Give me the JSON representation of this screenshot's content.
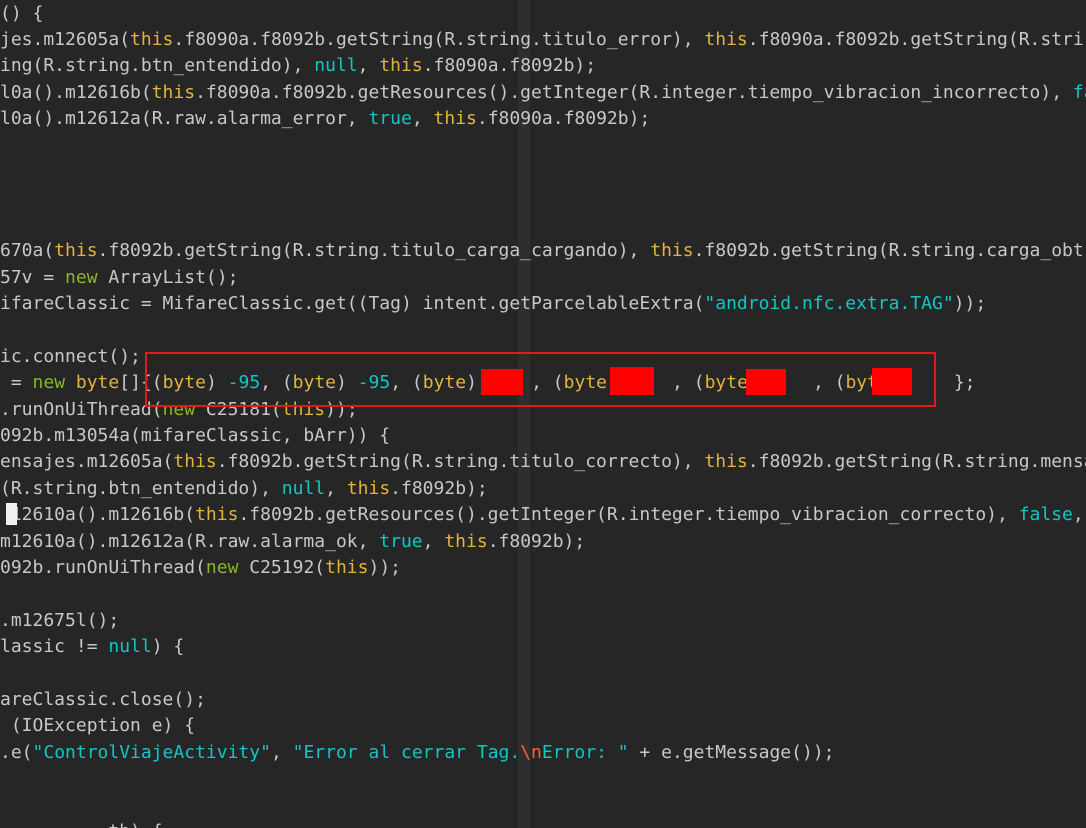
{
  "editor": {
    "lines": [
      {
        "parts": [
          {
            "t": "() {",
            "c": "plain"
          }
        ]
      },
      {
        "parts": [
          {
            "t": "jes.m12605a(",
            "c": "plain"
          },
          {
            "t": "this",
            "c": "this"
          },
          {
            "t": ".f8090a.f8092b.getString(R.string.titulo_error), ",
            "c": "plain"
          },
          {
            "t": "this",
            "c": "this"
          },
          {
            "t": ".f8090a.f8092b.getString(R.stri",
            "c": "plain"
          }
        ]
      },
      {
        "parts": [
          {
            "t": "ing(R.string.btn_entendido), ",
            "c": "plain"
          },
          {
            "t": "null",
            "c": "const"
          },
          {
            "t": ", ",
            "c": "plain"
          },
          {
            "t": "this",
            "c": "this"
          },
          {
            "t": ".f8090a.f8092b);",
            "c": "plain"
          }
        ]
      },
      {
        "parts": [
          {
            "t": "l0a().m12616b(",
            "c": "plain"
          },
          {
            "t": "this",
            "c": "this"
          },
          {
            "t": ".f8090a.f8092b.getResources().getInteger(R.integer.tiempo_vibracion_incorrecto), ",
            "c": "plain"
          },
          {
            "t": "fa",
            "c": "const"
          }
        ]
      },
      {
        "parts": [
          {
            "t": "l0a().m12612a(R.raw.alarma_error, ",
            "c": "plain"
          },
          {
            "t": "true",
            "c": "const"
          },
          {
            "t": ", ",
            "c": "plain"
          },
          {
            "t": "this",
            "c": "this"
          },
          {
            "t": ".f8090a.f8092b);",
            "c": "plain"
          }
        ]
      },
      {
        "parts": []
      },
      {
        "parts": []
      },
      {
        "parts": []
      },
      {
        "parts": []
      },
      {
        "parts": [
          {
            "t": "670a(",
            "c": "plain"
          },
          {
            "t": "this",
            "c": "this"
          },
          {
            "t": ".f8092b.getString(R.string.titulo_carga_cargando), ",
            "c": "plain"
          },
          {
            "t": "this",
            "c": "this"
          },
          {
            "t": ".f8092b.getString(R.string.carga_obt",
            "c": "plain"
          }
        ]
      },
      {
        "parts": [
          {
            "t": "57v = ",
            "c": "plain"
          },
          {
            "t": "new",
            "c": "new"
          },
          {
            "t": " ArrayList();",
            "c": "plain"
          }
        ]
      },
      {
        "parts": [
          {
            "t": "ifareClassic = MifareClassic.get((Tag) intent.getParcelableExtra(",
            "c": "plain"
          },
          {
            "t": "\"android.nfc.extra.TAG\"",
            "c": "str"
          },
          {
            "t": "));",
            "c": "plain"
          }
        ]
      },
      {
        "parts": []
      },
      {
        "parts": [
          {
            "t": "ic.connect();",
            "c": "plain"
          }
        ]
      },
      {
        "parts": [
          {
            "t": " = ",
            "c": "plain"
          },
          {
            "t": "new",
            "c": "new"
          },
          {
            "t": " ",
            "c": "plain"
          },
          {
            "t": "byte",
            "c": "kw"
          },
          {
            "t": "[]{(",
            "c": "plain"
          },
          {
            "t": "byte",
            "c": "kw"
          },
          {
            "t": ") ",
            "c": "plain"
          },
          {
            "t": "-95",
            "c": "num"
          },
          {
            "t": ", (",
            "c": "plain"
          },
          {
            "t": "byte",
            "c": "kw"
          },
          {
            "t": ") ",
            "c": "plain"
          },
          {
            "t": "-95",
            "c": "num"
          },
          {
            "t": ", (",
            "c": "plain"
          },
          {
            "t": "byte",
            "c": "kw"
          },
          {
            "t": ")     , (",
            "c": "plain"
          },
          {
            "t": "byte",
            "c": "kw"
          },
          {
            "t": ")     , (",
            "c": "plain"
          },
          {
            "t": "byte",
            "c": "kw"
          },
          {
            "t": ")     , (",
            "c": "plain"
          },
          {
            "t": "byte",
            "c": "kw"
          },
          {
            "t": ")     };",
            "c": "plain"
          }
        ]
      },
      {
        "parts": [
          {
            "t": ".runOnUiThread(",
            "c": "plain"
          },
          {
            "t": "new",
            "c": "new"
          },
          {
            "t": " C25181(",
            "c": "plain"
          },
          {
            "t": "this",
            "c": "this"
          },
          {
            "t": "));",
            "c": "plain"
          }
        ]
      },
      {
        "parts": [
          {
            "t": "092b.m13054a(mifareClassic, bArr)) {",
            "c": "plain"
          }
        ]
      },
      {
        "parts": [
          {
            "t": "ensajes.m12605a(",
            "c": "plain"
          },
          {
            "t": "this",
            "c": "this"
          },
          {
            "t": ".f8092b.getString(R.string.titulo_correcto), ",
            "c": "plain"
          },
          {
            "t": "this",
            "c": "this"
          },
          {
            "t": ".f8092b.getString(R.string.mensa",
            "c": "plain"
          }
        ]
      },
      {
        "parts": [
          {
            "t": "(R.string.btn_entendido), ",
            "c": "plain"
          },
          {
            "t": "null",
            "c": "const"
          },
          {
            "t": ", ",
            "c": "plain"
          },
          {
            "t": "this",
            "c": "this"
          },
          {
            "t": ".f8092b);",
            "c": "plain"
          }
        ]
      },
      {
        "parts": [
          {
            "t": " 12610a().m12616b(",
            "c": "plain"
          },
          {
            "t": "this",
            "c": "this"
          },
          {
            "t": ".f8092b.getResources().getInteger(R.integer.tiempo_vibracion_correcto), ",
            "c": "plain"
          },
          {
            "t": "false",
            "c": "const"
          },
          {
            "t": ",",
            "c": "plain"
          }
        ]
      },
      {
        "parts": [
          {
            "t": "m12610a().m12612a(R.raw.alarma_ok, ",
            "c": "plain"
          },
          {
            "t": "true",
            "c": "const"
          },
          {
            "t": ", ",
            "c": "plain"
          },
          {
            "t": "this",
            "c": "this"
          },
          {
            "t": ".f8092b);",
            "c": "plain"
          }
        ]
      },
      {
        "parts": [
          {
            "t": "092b.runOnUiThread(",
            "c": "plain"
          },
          {
            "t": "new",
            "c": "new"
          },
          {
            "t": " C25192(",
            "c": "plain"
          },
          {
            "t": "this",
            "c": "this"
          },
          {
            "t": "));",
            "c": "plain"
          }
        ]
      },
      {
        "parts": []
      },
      {
        "parts": [
          {
            "t": ".m12675l();",
            "c": "plain"
          }
        ]
      },
      {
        "parts": [
          {
            "t": "lassic != ",
            "c": "plain"
          },
          {
            "t": "null",
            "c": "const"
          },
          {
            "t": ") {",
            "c": "plain"
          }
        ]
      },
      {
        "parts": []
      },
      {
        "parts": [
          {
            "t": "areClassic.close();",
            "c": "plain"
          }
        ]
      },
      {
        "parts": [
          {
            "t": " (IOException e) {",
            "c": "plain"
          }
        ]
      },
      {
        "parts": [
          {
            "t": ".e(",
            "c": "plain"
          },
          {
            "t": "\"ControlViajeActivity\"",
            "c": "str"
          },
          {
            "t": ", ",
            "c": "plain"
          },
          {
            "t": "\"Error al cerrar Tag.",
            "c": "str"
          },
          {
            "t": "\\n",
            "c": "esc"
          },
          {
            "t": "Error: \"",
            "c": "str"
          },
          {
            "t": " + e.getMessage());",
            "c": "plain"
          }
        ]
      },
      {
        "parts": []
      },
      {
        "parts": []
      },
      {
        "parts": [
          {
            "t": "          th) {",
            "c": "plain"
          }
        ]
      }
    ]
  },
  "colors": {
    "background": "#262626",
    "plain": "#c8c8c8",
    "keyword": "#e3b33b",
    "constant": "#12c6c6",
    "new_keyword": "#89b52b",
    "escape": "#ff5f3a",
    "highlight_border": "#e21a1a",
    "redaction": "#ff0000"
  }
}
